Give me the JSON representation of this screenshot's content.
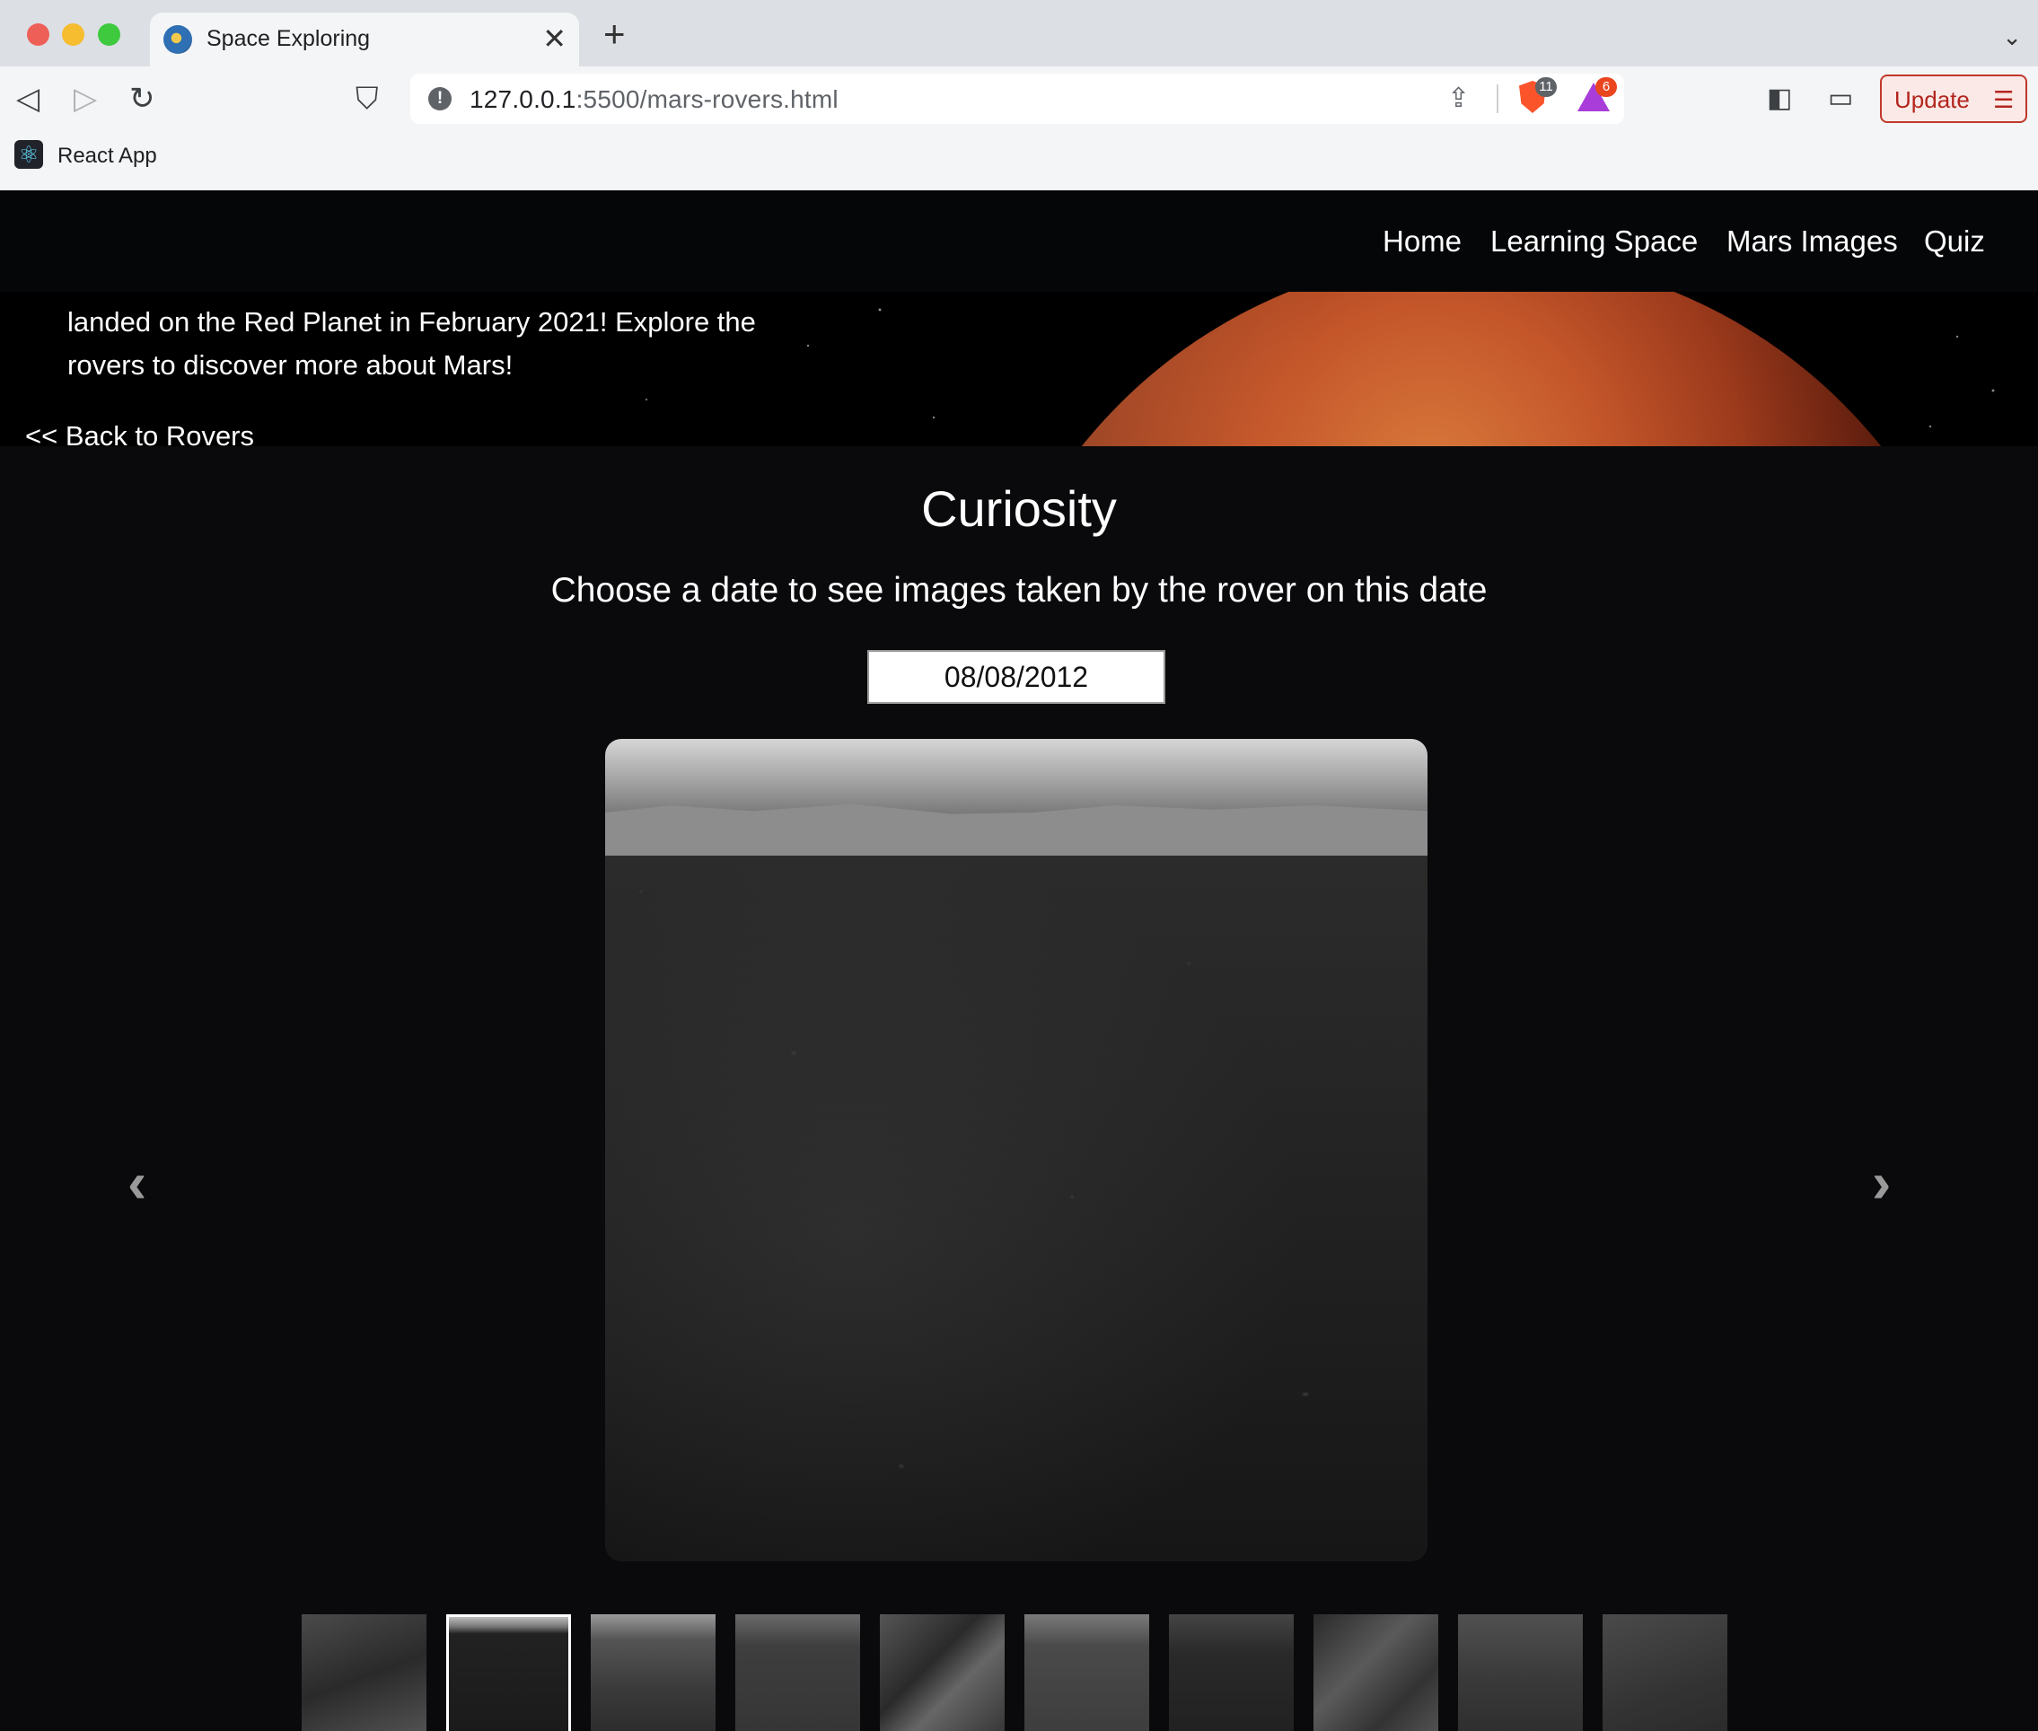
{
  "browser": {
    "tab_title": "Space Exploring",
    "tab_close": "✕",
    "new_tab": "+",
    "url_host": "127.0.0.1",
    "url_path": ":5500/mars-rovers.html",
    "update_label": "Update",
    "bookmark_label": "React App",
    "brave_badge": "11",
    "rewards_badge": "6",
    "colors": {
      "update_accent": "#b3261e"
    }
  },
  "nav": {
    "links": [
      "Home",
      "Learning Space",
      "Mars Images",
      "Quiz"
    ]
  },
  "hero": {
    "line1": "landed on the Red Planet in February 2021! Explore the",
    "line2": "rovers to discover more about Mars!",
    "back_link": "<< Back to Rovers"
  },
  "rover": {
    "name": "Curiosity",
    "instruction": "Choose a date to see images taken by the rover on this date",
    "date": "08/08/2012"
  },
  "carousel": {
    "prev_icon": "chevron-left-icon",
    "next_icon": "chevron-right-icon",
    "thumbnail_count": 10,
    "active_index": 1
  }
}
